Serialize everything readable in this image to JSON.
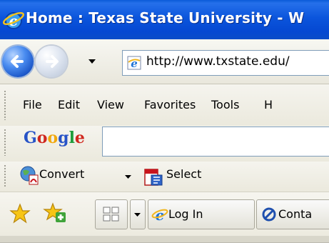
{
  "window": {
    "title": "Home : Texas State University - W"
  },
  "address_bar": {
    "url": "http://www.txstate.edu/"
  },
  "menu": {
    "items": [
      "File",
      "Edit",
      "View",
      "Favorites",
      "Tools",
      "H"
    ]
  },
  "google_toolbar": {
    "logo_letters": [
      "G",
      "o",
      "o",
      "g",
      "l",
      "e"
    ],
    "logo_colors": [
      "#2753c7",
      "#d0281f",
      "#f1a80e",
      "#2753c7",
      "#1e9c3b",
      "#d0281f"
    ],
    "search_value": ""
  },
  "pdf_toolbar": {
    "convert_label": "Convert",
    "select_label": "Select"
  },
  "favorites_bar": {
    "tabs": [
      "Log In",
      "Conta"
    ]
  },
  "colors": {
    "titlebar": "#0b55dc",
    "back_button": "#1c57c8"
  }
}
